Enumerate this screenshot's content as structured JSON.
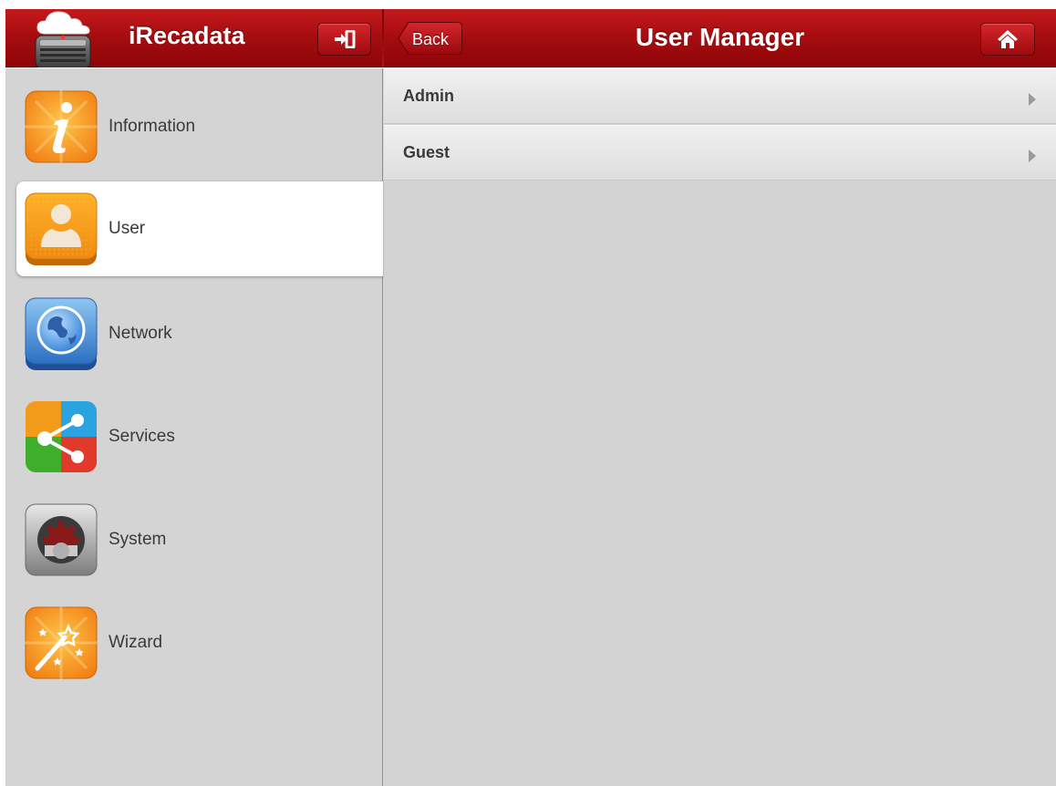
{
  "app": {
    "title": "iRecadata"
  },
  "header": {
    "back_label": "Back",
    "page_title": "User Manager"
  },
  "sidebar": {
    "items": [
      {
        "label": "Information",
        "icon": "information-icon"
      },
      {
        "label": "User",
        "icon": "user-icon",
        "active": true
      },
      {
        "label": "Network",
        "icon": "globe-icon"
      },
      {
        "label": "Services",
        "icon": "share-icon"
      },
      {
        "label": "System",
        "icon": "gear-icon"
      },
      {
        "label": "Wizard",
        "icon": "magic-wand-icon"
      }
    ]
  },
  "user_list": [
    {
      "label": "Admin"
    },
    {
      "label": "Guest"
    }
  ],
  "colors": {
    "header_red": "#a80d10",
    "sidebar_bg": "#d4d4d4",
    "content_bg": "#d3d3d3"
  }
}
